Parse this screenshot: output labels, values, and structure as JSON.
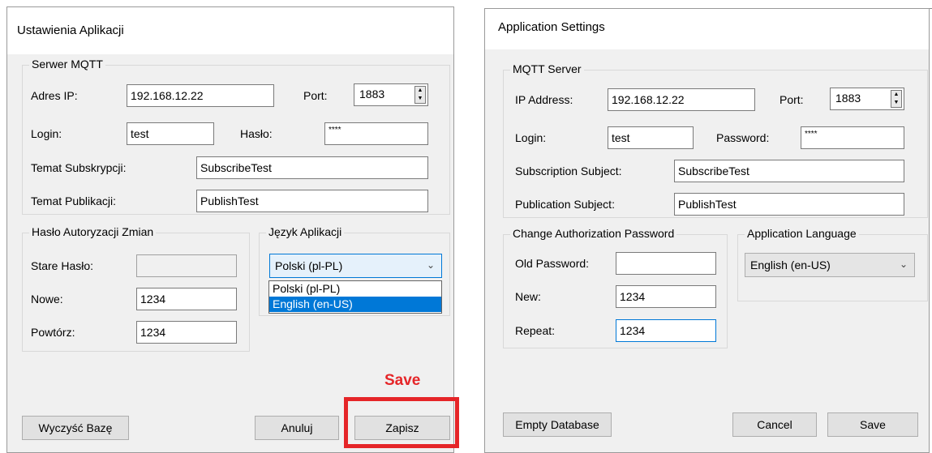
{
  "left": {
    "title": "Ustawienia Aplikacji",
    "mqtt_group": "Serwer MQTT",
    "ip_label": "Adres IP:",
    "ip_value": "192.168.12.22",
    "port_label": "Port:",
    "port_value": "1883",
    "login_label": "Login:",
    "login_value": "test",
    "password_label": "Hasło:",
    "password_value": "****",
    "sub_label": "Temat Subskrypcji:",
    "sub_value": "SubscribeTest",
    "pub_label": "Temat Publikacji:",
    "pub_value": "PublishTest",
    "auth_group": "Hasło Autoryzacji Zmian",
    "old_label": "Stare Hasło:",
    "old_value": "",
    "new_label": "Nowe:",
    "new_value": "1234",
    "repeat_label": "Powtórz:",
    "repeat_value": "1234",
    "lang_group": "Język Aplikacji",
    "lang_selected": "Polski (pl-PL)",
    "lang_options": [
      "Polski (pl-PL)",
      "English (en-US)"
    ],
    "clear_button": "Wyczyść Bazę",
    "cancel_button": "Anuluj",
    "save_button": "Zapisz"
  },
  "annotation": {
    "label": "Save",
    "color": "#e52528"
  },
  "right": {
    "title": "Application Settings",
    "mqtt_group": "MQTT Server",
    "ip_label": "IP Address:",
    "ip_value": "192.168.12.22",
    "port_label": "Port:",
    "port_value": "1883",
    "login_label": "Login:",
    "login_value": "test",
    "password_label": "Password:",
    "password_value": "****",
    "sub_label": "Subscription Subject:",
    "sub_value": "SubscribeTest",
    "pub_label": "Publication Subject:",
    "pub_value": "PublishTest",
    "auth_group": "Change Authorization Password",
    "old_label": "Old Password:",
    "old_value": "",
    "new_label": "New:",
    "new_value": "1234",
    "repeat_label": "Repeat:",
    "repeat_value": "1234",
    "lang_group": "Application Language",
    "lang_selected": "English (en-US)",
    "clear_button": "Empty Database",
    "cancel_button": "Cancel",
    "save_button": "Save"
  },
  "colors": {
    "window_bg": "#f0f0f0",
    "selection": "#0078d7",
    "annotation_red": "#e52528"
  }
}
